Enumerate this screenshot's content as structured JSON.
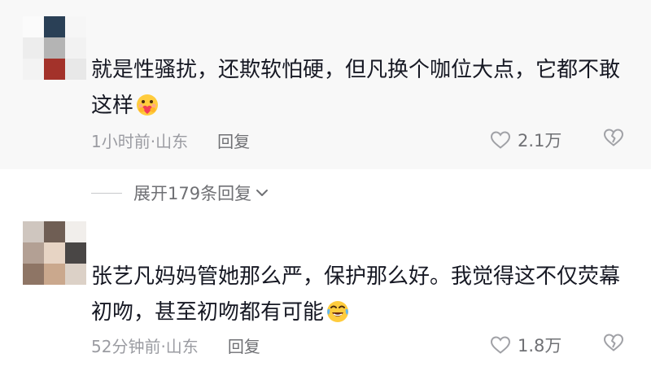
{
  "comments": [
    {
      "text": "就是性骚扰，还欺软怕硬，但凡换个咖位大点，它都不敢这样",
      "emoji": "heart-hug-emoji",
      "time": "1小时前·山东",
      "reply_label": "回复",
      "likes": "2.1万"
    },
    {
      "text": "张艺凡妈妈管她那么严，保护那么好。我觉得这不仅荧幕初吻，甚至初吻都有可能",
      "emoji": "crying-laughing-emoji",
      "time": "52分钟前·山东",
      "reply_label": "回复",
      "likes": "1.8万"
    }
  ],
  "expand": {
    "label": "展开179条回复"
  },
  "colors": {
    "background_highlight": "#f8f8f8",
    "text_primary": "#161823",
    "text_secondary": "#9b9ca2",
    "icon_gray": "#a0a1a6"
  }
}
